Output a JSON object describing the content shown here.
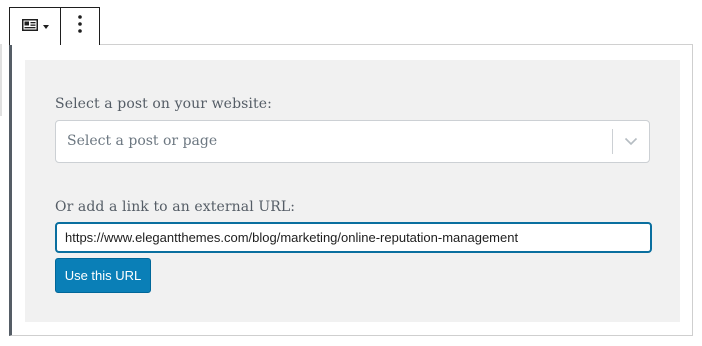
{
  "toolbar": {
    "block_icon": "id-card-icon",
    "more_icon": "vertical-ellipsis-icon"
  },
  "embed": {
    "post_label": "Select a post on your website:",
    "select_placeholder": "Select a post or page",
    "url_label": "Or add a link to an external URL:",
    "url_value": "https://www.elegantthemes.com/blog/marketing/online-reputation-management",
    "button_label": "Use this URL"
  },
  "colors": {
    "accent": "#0a7fb7",
    "panel_bg": "#f1f1f1",
    "focus_border": "#0a6f9f"
  }
}
